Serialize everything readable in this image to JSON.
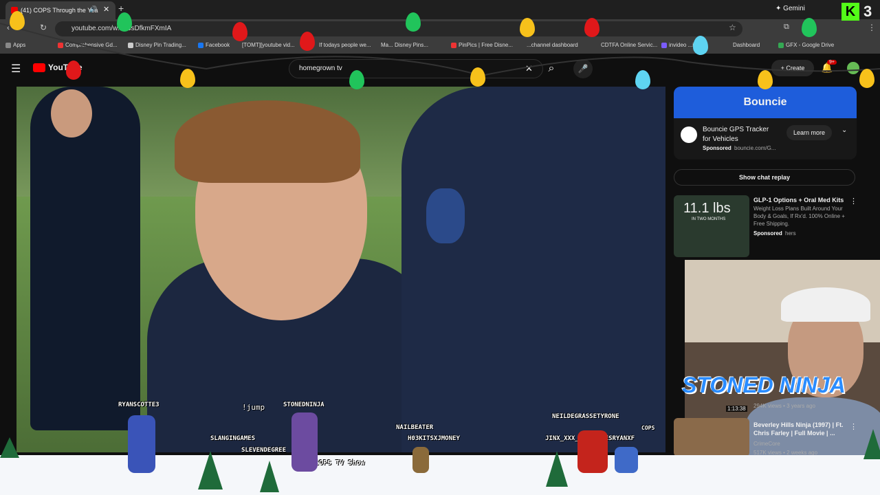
{
  "browser": {
    "tab_title": "(41) COPS Through the Yea",
    "new_tab": "+",
    "url": "youtube.com/w...=3sDfkmFXmIA",
    "gemini": "Gemini",
    "bookmarks": [
      "Apps",
      "Comprehensive Gd...",
      "Disney Pin Trading...",
      "Facebook",
      "[TOMT][youtube vid...",
      "If todays people we...",
      "Ma... Disney Pins...",
      "PinPics | Free Disne...",
      "...channel dashboard",
      "CDTFA Online Servic...",
      "invideo ...id...",
      "Dashboard",
      "GFX - Google Drive"
    ]
  },
  "youtube": {
    "logo": "YouTube",
    "search_value": "homegrown tv",
    "create_label": "Create",
    "notif_count": "9+"
  },
  "ad": {
    "banner": "Bouncie",
    "title": "Bouncie GPS Tracker for Vehicles",
    "sponsored": "Sponsored",
    "domain": "bouncie.com/G...",
    "cta": "Learn more"
  },
  "chat_replay": "Show chat replay",
  "ad2": {
    "title": "GLP-1 Options + Oral Med Kits",
    "desc": "Weight Loss Plans Built Around Your Body & Goals, If Rx'd. 100% Online + Free Shipping.",
    "sponsored": "Sponsored",
    "source": "hers",
    "thumb_text": "11.1 lbs",
    "thumb_sub": "IN TWO MONTHS"
  },
  "video2": {
    "title": "Beverley Hills Ninja (1997) | Ft. Chris Farley | Full Movie | ...",
    "channel": "CrimeCore",
    "meta": "517K views • 2 weeks ago"
  },
  "video1_meta": "294K views • 3 years ago",
  "video1_duration": "1:13:38",
  "overlay": {
    "brand": "K",
    "brand_num": "3",
    "streamer": "STONED NINJA",
    "chat_names": [
      "RYANSCOTTE3",
      "STONEDNINJA",
      "!jump",
      "NAILBEATER",
      "NEILDEGRASSETYRONE",
      "SLANGINGAMES",
      "H03KITSXJMONEY",
      "JINX_XXX_OTP JAMESRYANXF",
      "SLEVENDEGREE",
      "COPS"
    ],
    "lower_text": "...COPS TV Show"
  },
  "colors": {
    "accent": "#ff0000",
    "bouncie": "#1e5ddb"
  }
}
